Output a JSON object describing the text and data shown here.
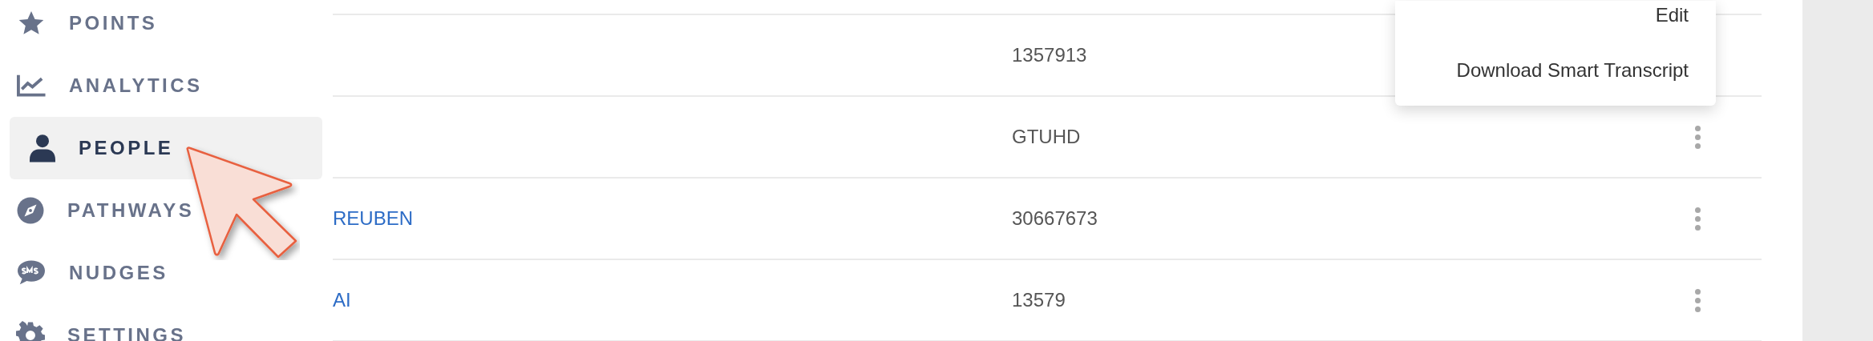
{
  "sidebar": {
    "items": [
      {
        "label": "POINTS",
        "selected": false
      },
      {
        "label": "ANALYTICS",
        "selected": false
      },
      {
        "label": "PEOPLE",
        "selected": true
      },
      {
        "label": "PATHWAYS",
        "selected": false
      },
      {
        "label": "NUDGES",
        "selected": false
      },
      {
        "label": "SETTINGS",
        "selected": false
      }
    ]
  },
  "table": {
    "rows": [
      {
        "value": "1357913",
        "menu_open": true
      },
      {
        "value": "GTUHD",
        "menu_open": false
      },
      {
        "name": "REUBEN",
        "value": "30667673",
        "menu_open": false
      },
      {
        "name": "AI",
        "value": "13579",
        "menu_open": false
      }
    ]
  },
  "row_menu": {
    "items": [
      "Edit",
      "Download Smart Transcript"
    ]
  }
}
